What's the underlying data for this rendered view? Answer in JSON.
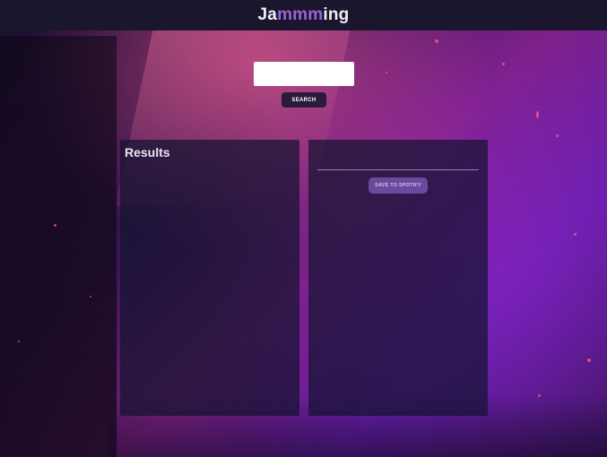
{
  "header": {
    "logo_part1": "Ja",
    "logo_accent": "mmm",
    "logo_part2": "ing"
  },
  "search": {
    "value": "",
    "placeholder": "",
    "button_label": "SEARCH"
  },
  "results": {
    "title": "Results",
    "tracks": []
  },
  "playlist": {
    "name_value": "",
    "tracks": [],
    "save_label": "SAVE TO SPOTIFY"
  },
  "colors": {
    "header_bg": "#19162d",
    "logo_accent": "#9b63d9",
    "panel_bg": "#141430",
    "search_button_bg": "#2c1a3c",
    "save_button_bg": "#6a4a9c"
  }
}
